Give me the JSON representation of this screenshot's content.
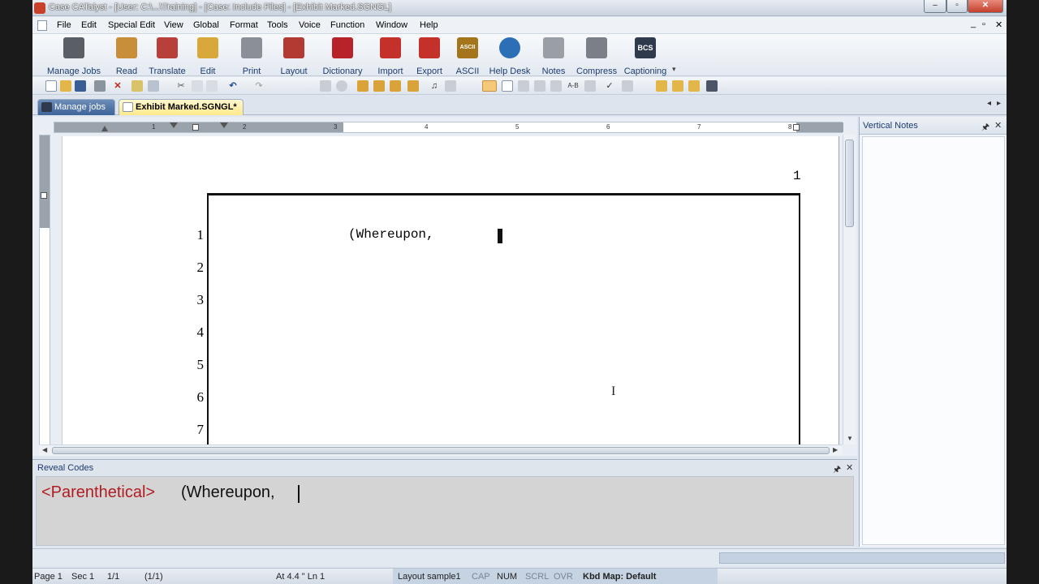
{
  "window": {
    "title": "Case CATalyst - [User: C:\\...\\Training] - [Case: Include Files] - [Exhibit Marked.SGNGL]",
    "controls": [
      "‒",
      "▫",
      "✕"
    ],
    "mdi_controls": [
      "_",
      "▫",
      "✕"
    ]
  },
  "menu": [
    "File",
    "Edit",
    "Special Edit",
    "View",
    "Global",
    "Format",
    "Tools",
    "Voice",
    "Function",
    "Window",
    "Help"
  ],
  "ribbon": [
    {
      "label": "Manage Jobs",
      "color": "#5a5f66"
    },
    {
      "label": "Read",
      "color": "#c98e3a"
    },
    {
      "label": "Translate",
      "color": "#b7413a"
    },
    {
      "label": "Edit",
      "color": "#d8a93a"
    },
    {
      "label": "Print",
      "color": "#8a8f98"
    },
    {
      "label": "Layout",
      "color": "#b23a33"
    },
    {
      "label": "Dictionary",
      "color": "#b8232a"
    },
    {
      "label": "Import",
      "color": "#c4302a"
    },
    {
      "label": "Export",
      "color": "#c4302a"
    },
    {
      "label": "ASCII",
      "color": "#a5751c"
    },
    {
      "label": "Help Desk",
      "color": "#2d6fb6"
    },
    {
      "label": "Notes",
      "color": "#9a9ea5"
    },
    {
      "label": "Compress",
      "color": "#7a7f88"
    },
    {
      "label": "Captioning",
      "color": "#2f3a4c"
    }
  ],
  "ribbon_icon_text": {
    "ascii": "ASCII",
    "captioning": "BCS"
  },
  "tabs": {
    "manage": "Manage jobs",
    "document": "Exhibit Marked.SGNGL*"
  },
  "ruler_numbers": [
    "1",
    "2",
    "3",
    "4",
    "5",
    "6",
    "7",
    "8"
  ],
  "document": {
    "page_number": "1",
    "line_numbers": [
      "1",
      "2",
      "3",
      "4",
      "5",
      "6",
      "7"
    ],
    "line1_text": "(Whereupon,"
  },
  "vertical_notes": {
    "title": "Vertical Notes",
    "pin": "🖈",
    "close": "✕"
  },
  "reveal_codes": {
    "title": "Reveal Codes",
    "code": "<Parenthetical>",
    "text": "(Whereupon,"
  },
  "status": {
    "page": "Page 1",
    "sec": "Sec 1",
    "fraction": "1/1",
    "fraction2": "(1/1)",
    "position": "At 4.4 \"  Ln 1",
    "layout": "Layout sample1",
    "cap": "CAP",
    "num": "NUM",
    "scrl": "SCRL",
    "ovr": "OVR",
    "kbd": "Kbd Map: Default"
  }
}
